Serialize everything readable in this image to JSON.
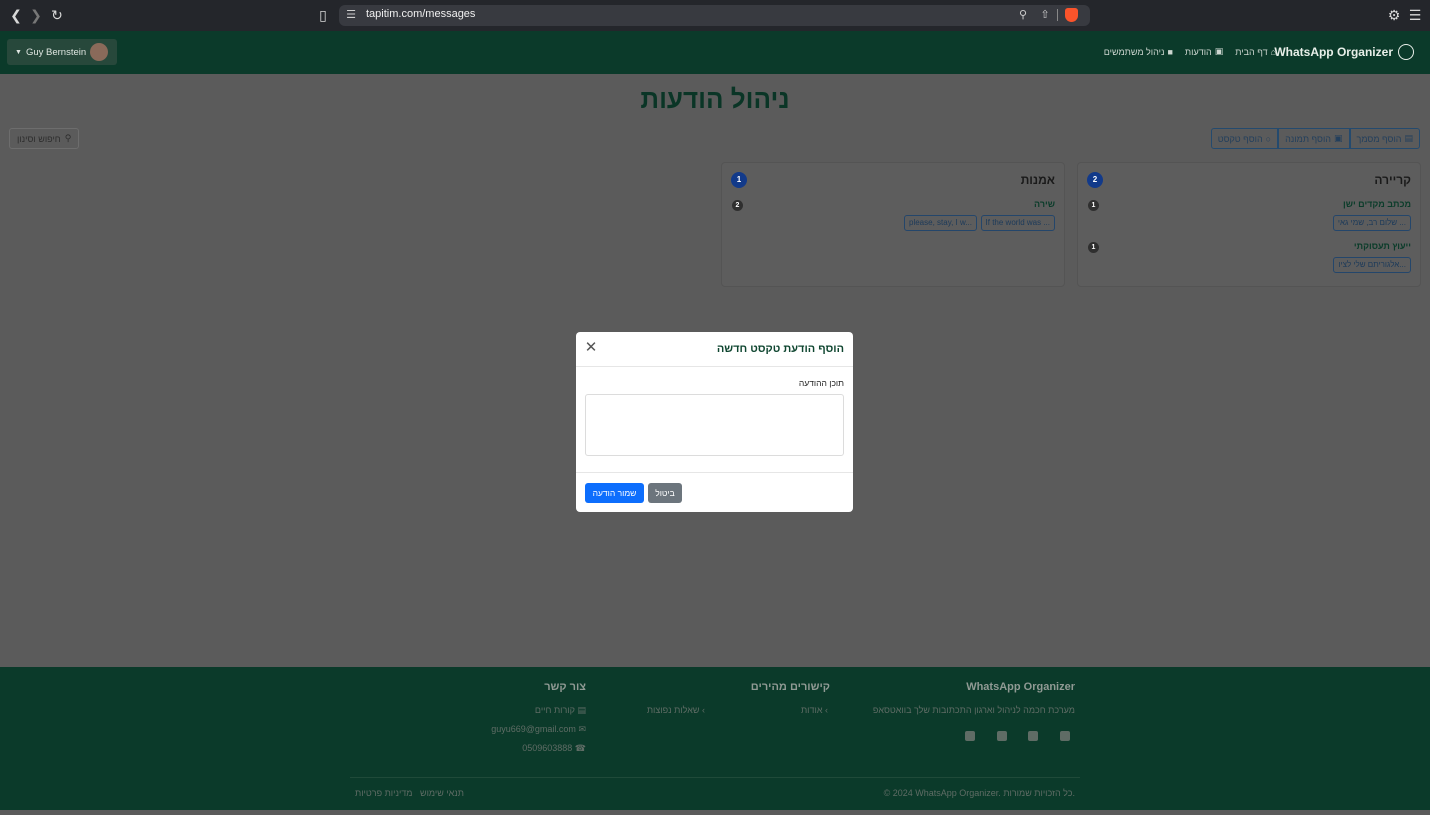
{
  "browser": {
    "url": "tapitim.com/messages"
  },
  "navbar": {
    "brand": "WhatsApp Organizer",
    "links": [
      "דף הבית",
      "הודעות",
      "ניהול משתמשים"
    ],
    "user": "Guy Bernstein"
  },
  "main": {
    "title": "ניהול הודעות",
    "actions": [
      "הוסף מסמך",
      "הוסף תמונה",
      "הוסף טקסט"
    ],
    "search_label": "חיפוש וסינון",
    "categories": [
      {
        "title": "קריירה",
        "count": "2",
        "groups": [
          {
            "title": "מכתב מקדים ישן",
            "count": "1",
            "items": [
              "שלום רב, שמי גאי ..."
            ]
          },
          {
            "title": "ייעוץ תעסוקתי",
            "count": "1",
            "items": [
              "אלגוריתם שלי לציו..."
            ]
          }
        ]
      },
      {
        "title": "אמנות",
        "count": "1",
        "groups": [
          {
            "title": "שירה",
            "count": "2",
            "items": [
              "If the world was ...",
              "please, stay, I w..."
            ]
          }
        ]
      }
    ]
  },
  "footer": {
    "brand": "WhatsApp Organizer",
    "description": "מערכת חכמה לניהול וארגון התכתובות שלך בוואטסאפ",
    "quick_links_title": "קישורים מהירים",
    "quick_links": [
      "אודות",
      "שאלות נפוצות"
    ],
    "contact_title": "צור קשר",
    "contact": [
      "קורות חיים",
      "guyu669@gmail.com",
      "0509603888"
    ],
    "copyright": "© 2024 WhatsApp Organizer. כל הזכויות שמורות.",
    "legal": [
      "תנאי שימוש",
      "מדיניות פרטיות"
    ]
  },
  "modal": {
    "title": "הוסף הודעת טקסט חדשה",
    "field_label": "תוכן ההודעה",
    "textarea_value": "",
    "save_label": "שמור הודעה",
    "cancel_label": "ביטול"
  }
}
